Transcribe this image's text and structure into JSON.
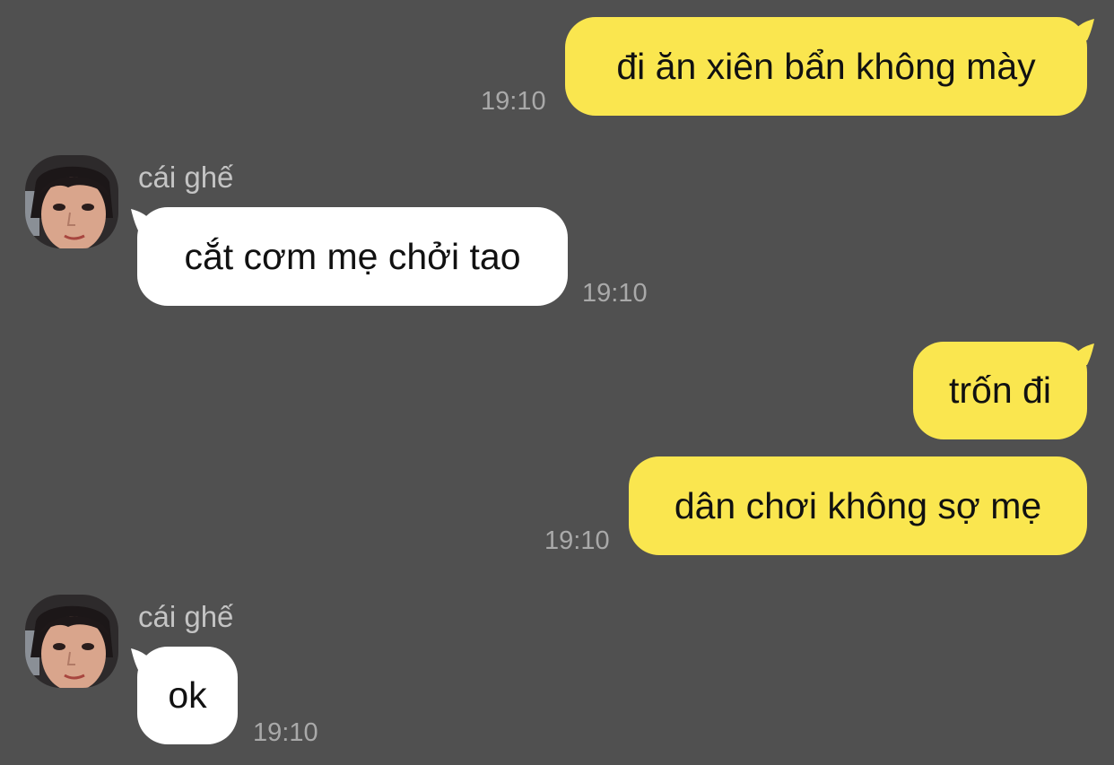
{
  "colors": {
    "background": "#505050",
    "outgoing_bubble": "#fae64f",
    "incoming_bubble": "#ffffff",
    "timestamp": "#a9a9a9",
    "sender_name": "#c4c4c4"
  },
  "messages": [
    {
      "direction": "outgoing",
      "text": "đi ăn xiên bẩn không mày",
      "time": "19:10"
    },
    {
      "direction": "incoming",
      "sender": "cái ghế",
      "avatar_icon": "user-photo-avatar",
      "text": "cắt cơm mẹ chởi tao",
      "time": "19:10"
    },
    {
      "direction": "outgoing",
      "text": "trốn đi"
    },
    {
      "direction": "outgoing",
      "text": "dân chơi không sợ mẹ",
      "time": "19:10"
    },
    {
      "direction": "incoming",
      "sender": "cái ghế",
      "avatar_icon": "user-photo-avatar",
      "text": "ok",
      "time": "19:10"
    }
  ]
}
